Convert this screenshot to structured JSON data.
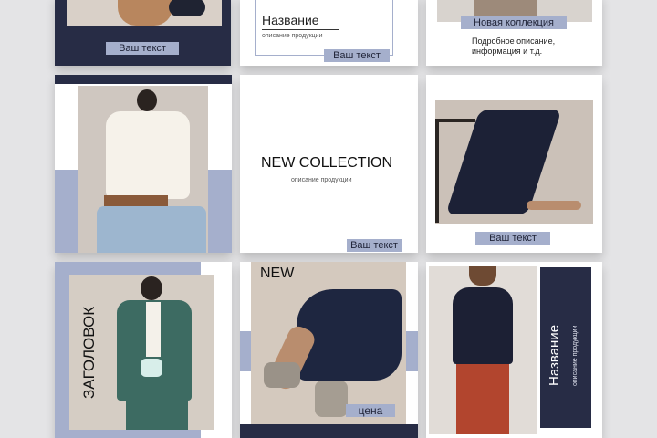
{
  "tiles": {
    "top_left": {
      "tag": "Ваш текст"
    },
    "top_mid": {
      "title": "Название",
      "subtitle": "описание продукции",
      "tag": "Ваш текст"
    },
    "top_right": {
      "tag": "Новая коллекция",
      "desc_line1": "Подробное описание,",
      "desc_line2": "информация и т.д."
    },
    "center": {
      "title": "NEW COLLECTION",
      "subtitle": "описание продукции",
      "tag": "Ваш текст"
    },
    "mid_right": {
      "tag": "Ваш текст"
    },
    "bottom_left": {
      "vertical_title": "ЗАГОЛОВОК"
    },
    "bottom_mid": {
      "title": "NEW",
      "price": "цена"
    },
    "bottom_right": {
      "vertical_title": "Название",
      "vertical_subtitle": "описание продукции"
    }
  },
  "colors": {
    "navy": "#272c45",
    "lavender": "#a5afcc",
    "background": "#e4e4e6"
  }
}
